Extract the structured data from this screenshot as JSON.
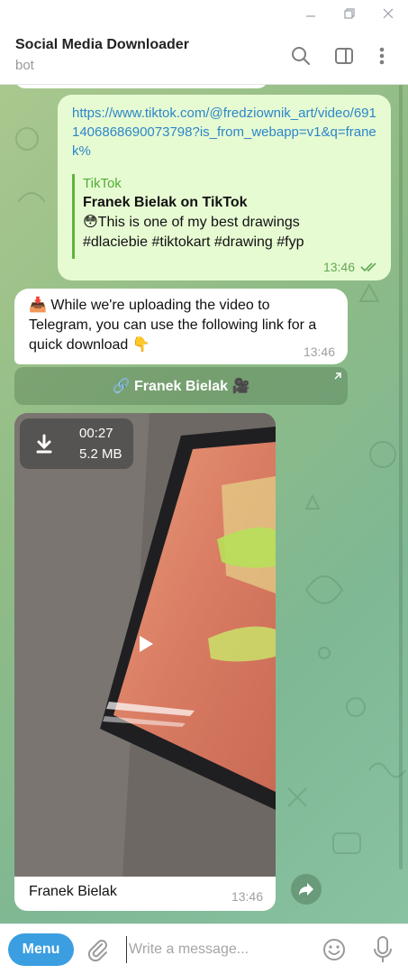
{
  "window": {
    "controls": [
      "minimize-icon",
      "maximize-icon",
      "close-icon"
    ]
  },
  "header": {
    "title": "Social Media Downloader",
    "subtitle": "bot",
    "icons": [
      "search-icon",
      "sidebar-toggle-icon",
      "more-vertical-icon"
    ]
  },
  "messages": {
    "outgoing": {
      "link": "https://www.tiktok.com/@fredziownik_art/video/6911406868690073798?is_from_webapp=v1&q=franek%",
      "preview_site": "TikTok",
      "preview_title": "Franek Bielak on TikTok",
      "preview_desc": "😳This is one of my best drawings #dlaciebie #tiktokart #drawing #fyp",
      "time": "13:46",
      "status_icon": "double-check-icon"
    },
    "incoming_text": {
      "text": "📥 While we're uploading the video to Telegram, you can use the following link for a quick download 👇",
      "time": "13:46"
    },
    "inline_button": {
      "label": "🔗 Franek Bielak 🎥",
      "icon": "external-link-corner-icon"
    },
    "video": {
      "duration": "00:27",
      "size": "5.2 MB",
      "caption": "Franek Bielak",
      "time": "13:46"
    }
  },
  "composer": {
    "menu_label": "Menu",
    "placeholder": "Write a message...",
    "value": ""
  },
  "colors": {
    "outgoing_bubble": "#e7fbd3",
    "incoming_bubble": "#ffffff",
    "link": "#2c86c8",
    "accent": "#3a9ee0",
    "preview_bar": "#5fb43e"
  }
}
